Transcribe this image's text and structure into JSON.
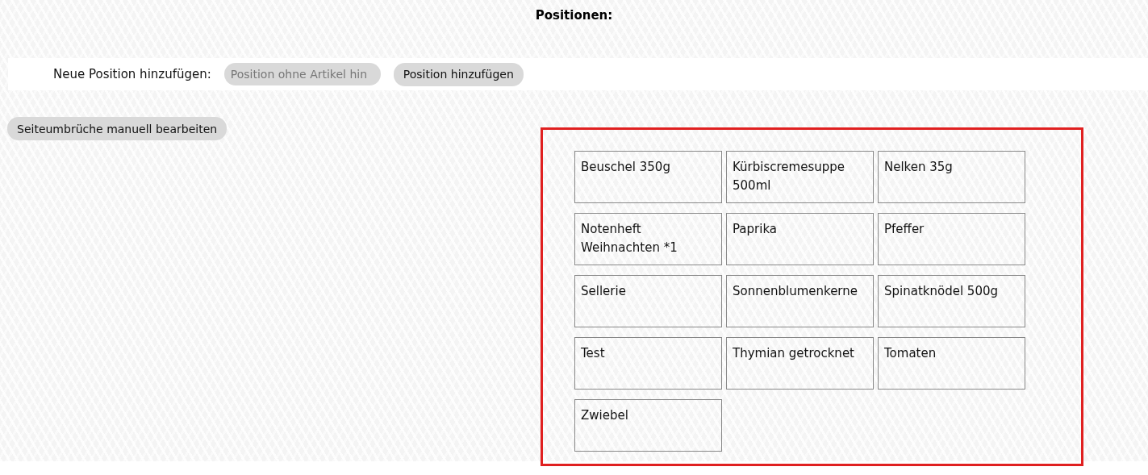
{
  "heading": "Positionen:",
  "add_row": {
    "label": "Neue Position hinzufügen:",
    "field": {
      "placeholder": "Position ohne Artikel hin"
    },
    "button": "Position hinzufügen"
  },
  "page_break_button": "Seiteumbrüche manuell bearbeiten",
  "items": [
    {
      "name": "Beuschel 350g"
    },
    {
      "name": "Kürbiscremesuppe 500ml"
    },
    {
      "name": "Nelken 35g"
    },
    {
      "name": "Notenheft Weihnachten *1"
    },
    {
      "name": "Paprika"
    },
    {
      "name": "Pfeffer"
    },
    {
      "name": "Sellerie"
    },
    {
      "name": "Sonnenblumenkerne"
    },
    {
      "name": "Spinatknödel 500g"
    },
    {
      "name": "Test"
    },
    {
      "name": "Thymian getrocknet"
    },
    {
      "name": "Tomaten"
    },
    {
      "name": "Zwiebel"
    }
  ]
}
